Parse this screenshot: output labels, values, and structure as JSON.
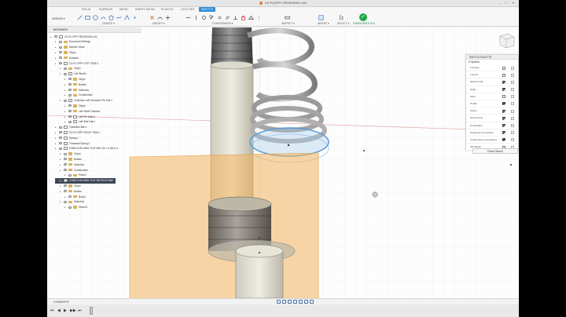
{
  "window": {
    "title": "CD FLOPPY REDESIGN v34*",
    "controls": [
      "–",
      "□",
      "✕"
    ]
  },
  "ribbon": {
    "tabs": [
      "SOLID",
      "SURFACE",
      "MESH",
      "SHEET METAL",
      "PLASTIC",
      "UTILITIES",
      "SKETCH"
    ],
    "active_tab": "SKETCH",
    "workspace": "DESIGN ▾",
    "groups": [
      "CREATE ▾",
      "MODIFY ▾",
      "CONSTRAINTS ▾",
      "INSPECT ▾",
      "INSERT ▾",
      "SELECT ▾",
      "FINISH SKETCH ▾"
    ],
    "finish_icon": "checkmark-icon"
  },
  "browser": {
    "title": "BROWSER",
    "nodes": [
      {
        "label": "CD FLOPPY REDESIGN v34",
        "level": 0
      },
      {
        "label": "Document Settings",
        "level": 1
      },
      {
        "label": "Named Views",
        "level": 1
      },
      {
        "label": "Origin",
        "level": 1
      },
      {
        "label": "Analysis",
        "level": 1
      },
      {
        "label": "CD FLOPPY LEFT SIDE:1",
        "level": 1
      },
      {
        "label": "Origin",
        "level": 2
      },
      {
        "label": "Left Shaft:1",
        "level": 2
      },
      {
        "label": "Origin",
        "level": 3
      },
      {
        "label": "Bodies",
        "level": 3
      },
      {
        "label": "Sketches",
        "level": 3
      },
      {
        "label": "Construction",
        "level": 3
      },
      {
        "label": "Collection Left Chamber Pin Sub:1",
        "level": 2
      },
      {
        "label": "Origin",
        "level": 3
      },
      {
        "label": "Left Shaft Chamber",
        "level": 3
      },
      {
        "label": "Left Pin Hole:1",
        "level": 3
      },
      {
        "label": "Left Side Hat:1",
        "level": 3
      },
      {
        "label": "Transition Bar:1",
        "level": 1
      },
      {
        "label": "CD FLOPPY RIGHT SIDE:1",
        "level": 1
      },
      {
        "label": "Spring:1",
        "level": 1
      },
      {
        "label": "Threaded Spring:1",
        "level": 1
      },
      {
        "label": "5 BMX 8.5% BMX 7/16\" 5/8 x 20 x 4.38 v1:1",
        "level": 1
      },
      {
        "label": "Origin",
        "level": 2
      },
      {
        "label": "Bodies",
        "level": 2
      },
      {
        "label": "Sketches",
        "level": 2
      },
      {
        "label": "Construction",
        "level": 2
      },
      {
        "label": "Plane1",
        "level": 3
      },
      {
        "label": "5 BMX 8.5% BMX 7/16\" 5/8 FM 20 Bolt",
        "level": 1
      },
      {
        "label": "Origin",
        "level": 2
      },
      {
        "label": "Bodies",
        "level": 2
      },
      {
        "label": "Body1",
        "level": 3
      },
      {
        "label": "Sketches",
        "level": 2
      },
      {
        "label": "Sketch1",
        "level": 3
      }
    ]
  },
  "palette": {
    "title": "SKETCH PALETTE",
    "section": "Options",
    "rows": [
      {
        "label": "Linetype",
        "checked": false
      },
      {
        "label": "Look At",
        "checked": false
      },
      {
        "label": "Sketch Grid",
        "checked": true
      },
      {
        "label": "Snap",
        "checked": true
      },
      {
        "label": "Slice",
        "checked": false
      },
      {
        "label": "Profile",
        "checked": true
      },
      {
        "label": "Points",
        "checked": true
      },
      {
        "label": "Dimensions",
        "checked": true
      },
      {
        "label": "Constraints",
        "checked": true
      },
      {
        "label": "Projected Geometries",
        "checked": true
      },
      {
        "label": "Construction Geometries",
        "checked": true
      },
      {
        "label": "3D Sketch",
        "checked": false
      }
    ],
    "finish_label": "Finish Sketch"
  },
  "bottom": {
    "comments_label": "COMMENTS",
    "timeline_controls": [
      "⏮",
      "◀",
      "▶",
      "▶▶",
      "⏭"
    ]
  },
  "colors": {
    "accent": "#2e8ad6",
    "finish_green": "#1ea84a",
    "sketch_plane": "#f2b25c",
    "selected_row": "#3d4756"
  }
}
